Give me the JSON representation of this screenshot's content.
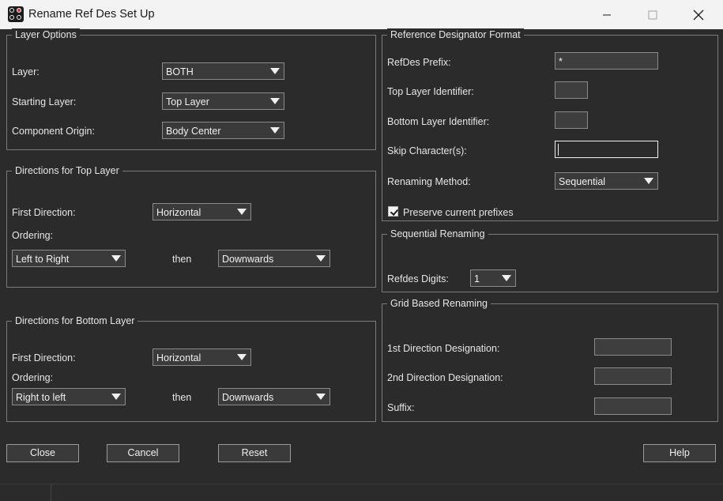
{
  "window": {
    "title": "Rename Ref Des Set Up",
    "controls": {
      "minimize": "—",
      "maximize": "☐",
      "close": "✕"
    }
  },
  "layer_options": {
    "title": "Layer Options",
    "layer_label": "Layer:",
    "layer_value": "BOTH",
    "starting_layer_label": "Starting Layer:",
    "starting_layer_value": "Top Layer",
    "component_origin_label": "Component Origin:",
    "component_origin_value": "Body Center"
  },
  "top_directions": {
    "title": "Directions for Top Layer",
    "first_direction_label": "First Direction:",
    "first_direction_value": "Horizontal",
    "ordering_label": "Ordering:",
    "ordering_1_value": "Left to Right",
    "then_label": "then",
    "ordering_2_value": "Downwards"
  },
  "bottom_directions": {
    "title": "Directions for Bottom Layer",
    "first_direction_label": "First Direction:",
    "first_direction_value": "Horizontal",
    "ordering_label": "Ordering:",
    "ordering_1_value": "Right to left",
    "then_label": "then",
    "ordering_2_value": "Downwards"
  },
  "refdes_format": {
    "title": "Reference Designator Format",
    "prefix_label": "RefDes Prefix:",
    "prefix_value": "*",
    "top_identifier_label": "Top Layer Identifier:",
    "top_identifier_value": "",
    "bottom_identifier_label": "Bottom Layer Identifier:",
    "bottom_identifier_value": "",
    "skip_label": "Skip Character(s):",
    "skip_value": "",
    "method_label": "Renaming Method:",
    "method_value": "Sequential",
    "preserve_label": "Preserve current prefixes",
    "preserve_checked": true
  },
  "sequential": {
    "title": "Sequential Renaming",
    "digits_label": "Refdes Digits:",
    "digits_value": "1"
  },
  "grid": {
    "title": "Grid Based Renaming",
    "first_label": "1st Direction Designation:",
    "first_value": "",
    "second_label": "2nd Direction Designation:",
    "second_value": "",
    "suffix_label": "Suffix:",
    "suffix_value": ""
  },
  "buttons": {
    "close": "Close",
    "cancel": "Cancel",
    "reset": "Reset",
    "help": "Help"
  },
  "icons": {
    "app": "app-logo-icon",
    "dropdown": "chevron-down-icon",
    "check": "check-icon"
  },
  "colors": {
    "background": "#2b2b2b",
    "titlebar": "#f3f3f3",
    "border": "#7a7a7a",
    "text": "#e6e6e6",
    "icon_accent": "#d9363e"
  }
}
